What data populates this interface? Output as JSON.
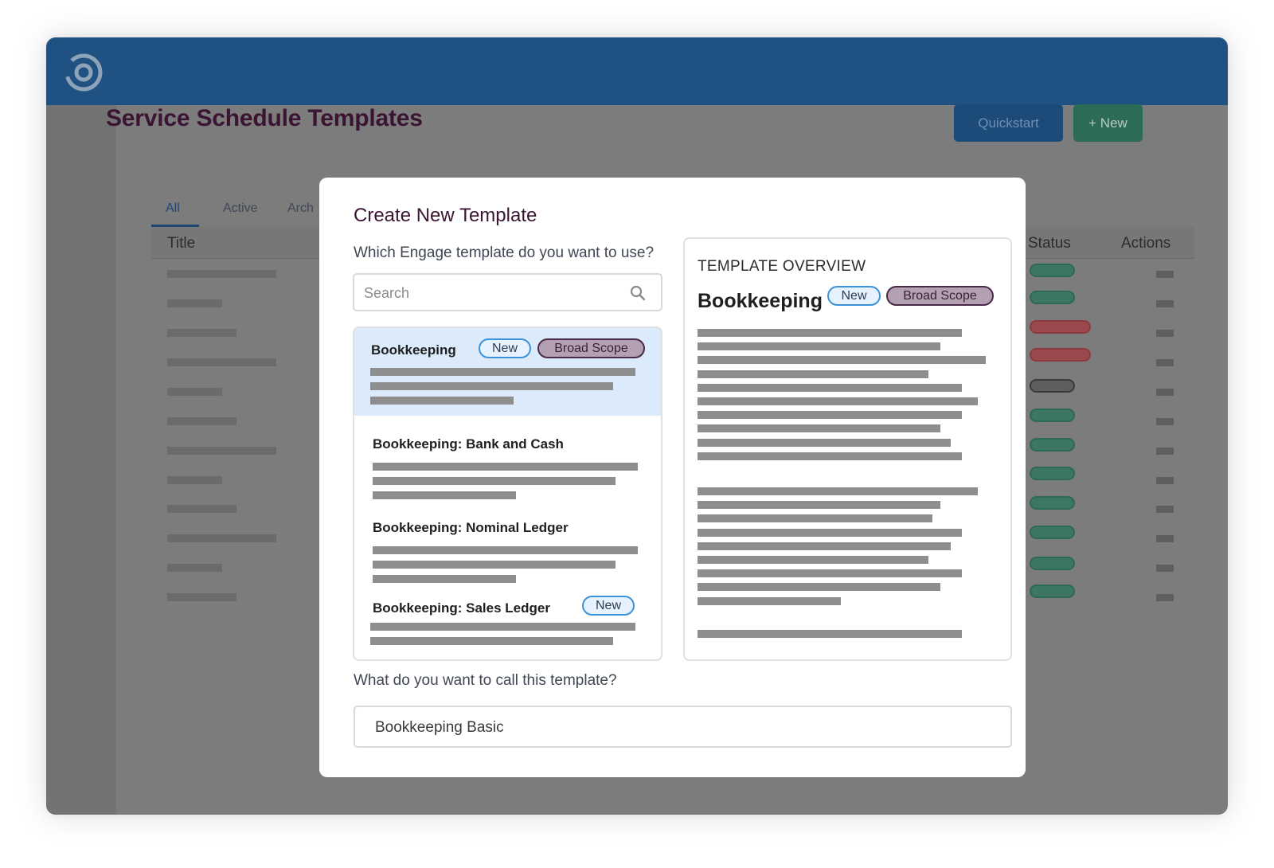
{
  "page": {
    "title": "Service Schedule Templates",
    "quickstart_label": "Quickstart",
    "new_label": "+ New",
    "tabs": [
      "All",
      "Active",
      "Arch"
    ],
    "columns": {
      "title": "Title",
      "status": "Status",
      "actions": "Actions"
    },
    "row_statuses": [
      "active",
      "active",
      "error",
      "error",
      "inactive",
      "active",
      "active",
      "active",
      "active",
      "active",
      "active",
      "active"
    ]
  },
  "modal": {
    "title": "Create New Template",
    "question_template": "Which Engage template do you want to use?",
    "search_placeholder": "Search",
    "list": [
      {
        "title": "Bookkeeping",
        "badges": [
          "New",
          "Broad Scope"
        ],
        "selected": true
      },
      {
        "title": "Bookkeeping: Bank and Cash",
        "badges": [],
        "selected": false
      },
      {
        "title": "Bookkeeping: Nominal Ledger",
        "badges": [],
        "selected": false
      },
      {
        "title": "Bookkeeping: Sales Ledger",
        "badges": [
          "New"
        ],
        "selected": false
      }
    ],
    "overview": {
      "heading": "TEMPLATE OVERVIEW",
      "title": "Bookkeeping",
      "badges": [
        "New",
        "Broad Scope"
      ]
    },
    "question_name": "What do you want to call this template?",
    "name_value": "Bookkeeping Basic"
  },
  "colors": {
    "topbar": "#1f5183",
    "title": "#3a1432",
    "badge_new_border": "#3d93da",
    "badge_scope_border": "#4a2a48",
    "selected_row": "#dcebfb"
  }
}
